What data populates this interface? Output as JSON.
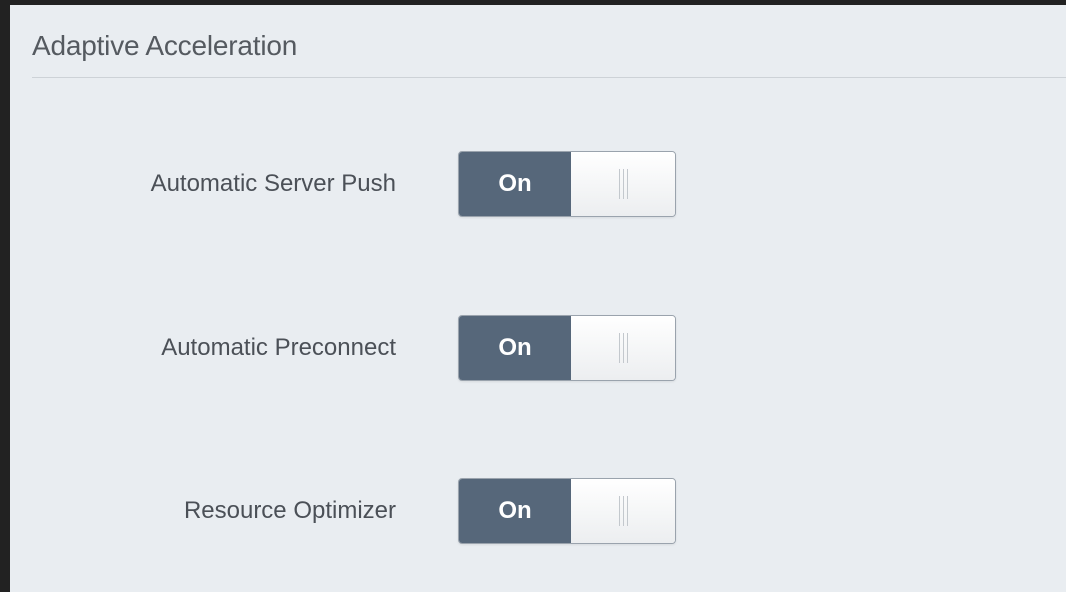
{
  "section": {
    "title": "Adaptive Acceleration"
  },
  "settings": [
    {
      "label": "Automatic Server Push",
      "state_label": "On",
      "enabled": true
    },
    {
      "label": "Automatic Preconnect",
      "state_label": "On",
      "enabled": true
    },
    {
      "label": "Resource Optimizer",
      "state_label": "On",
      "enabled": true
    }
  ],
  "colors": {
    "background": "#222222",
    "panel": "#e9edf1",
    "toggle_on": "#56677a",
    "text": "#4b5057"
  }
}
